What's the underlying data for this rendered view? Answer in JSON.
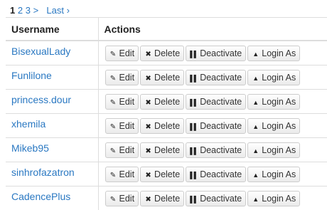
{
  "pagination": {
    "current": "1",
    "pages": [
      "2",
      "3"
    ],
    "next": ">",
    "last": "Last ›"
  },
  "table": {
    "headers": {
      "username": "Username",
      "actions": "Actions"
    },
    "rows": [
      {
        "username": "BisexualLady"
      },
      {
        "username": "Funlilone"
      },
      {
        "username": "princess.dour"
      },
      {
        "username": "xhemila"
      },
      {
        "username": "Mikeb95"
      },
      {
        "username": "sinhrofazatron"
      },
      {
        "username": "CadencePlus"
      }
    ]
  },
  "actions": {
    "edit": "Edit",
    "delete": "Delete",
    "deactivate": "Deactivate",
    "login_as": "Login As"
  },
  "icons": {
    "edit": "pencil-icon",
    "delete": "x-icon",
    "deactivate": "pause-icon",
    "login_as": "user-icon"
  },
  "colors": {
    "link": "#2a78c2",
    "border": "#dddddd"
  }
}
